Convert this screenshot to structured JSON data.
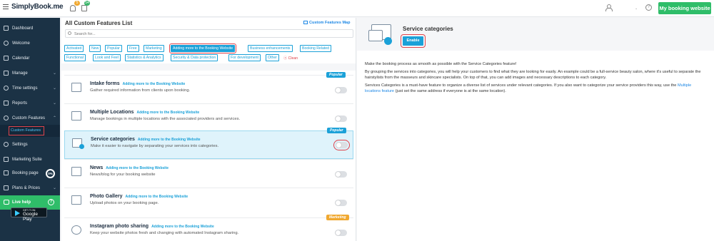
{
  "topbar": {
    "logo": "SimplyBook.me",
    "notifications_count": "5",
    "calendar_count": "54",
    "my_booking_website": "My booking website"
  },
  "sidebar": {
    "items": [
      {
        "label": "Dashboard",
        "icon": "dashboard-icon"
      },
      {
        "label": "Welcome",
        "icon": "welcome-icon"
      },
      {
        "label": "Calendar",
        "icon": "calendar-icon"
      },
      {
        "label": "Manage",
        "icon": "pencil-icon",
        "chevron": "⌄"
      },
      {
        "label": "Time settings",
        "icon": "clock-icon",
        "chevron": "⌄"
      },
      {
        "label": "Reports",
        "icon": "reports-icon",
        "chevron": "⌄"
      },
      {
        "label": "Custom Features",
        "icon": "gear-icon",
        "chevron": "⌃"
      },
      {
        "label": "Settings",
        "icon": "settings-icon"
      },
      {
        "label": "Marketing Suite",
        "icon": "megaphone-icon"
      },
      {
        "label": "Booking page",
        "icon": "booking-page-icon"
      },
      {
        "label": "Plans & Prices",
        "icon": "plans-icon",
        "chevron": "⌄"
      }
    ],
    "sub_item": "Custom Features",
    "booking_progress": "0%",
    "live_help": "Live help",
    "gplay_small": "GET IT ON",
    "gplay_big": "Google Play",
    "appstore": "Download on the"
  },
  "list": {
    "title": "All Custom Features List",
    "features_map": "Custom Features Map",
    "search_placeholder": "Search for...",
    "chips": [
      "Activated",
      "New",
      "Popular",
      "Free",
      "Marketing",
      "Adding more to the Booking Website",
      "Business enhancements",
      "Booking Related",
      "Functional",
      "Look and Feel",
      "Statistics & Analytics",
      "Security & Data protection",
      "For development",
      "Other"
    ],
    "clean": "Clean",
    "features": [
      {
        "name": "Intake forms",
        "tag": "Adding more to the Booking Website",
        "desc": "Gather required information from clients upon booking.",
        "badge": "Popular"
      },
      {
        "name": "Multiple Locations",
        "tag": "Adding more to the Booking Website",
        "desc": "Manage bookings in multiple locations with the associated providers and services.",
        "badge": ""
      },
      {
        "name": "Service categories",
        "tag": "Adding more to the Booking Website",
        "desc": "Make it easier to navigate by separating your services into categories.",
        "badge": "Popular"
      },
      {
        "name": "News",
        "tag": "Adding more to the Booking Website",
        "desc": "News/blog for your booking website",
        "badge": ""
      },
      {
        "name": "Photo Gallery",
        "tag": "Adding more to the Booking Website",
        "desc": "Upload photos on your booking page.",
        "badge": ""
      },
      {
        "name": "Instagram photo sharing",
        "tag": "Adding more to the Booking Website",
        "desc": "Keep your website photos fresh and changing with automated Instagram sharing.",
        "badge": "Marketing"
      }
    ]
  },
  "detail": {
    "title": "Service categories",
    "enable": "Enable",
    "p1": "Make the booking process as smooth as possible with the Service Categories feature!",
    "p2": "By grouping the services into categories, you will help your customers to find what they are looking for easily. An example could be a full-service beauty salon, where it's useful to separate the hairstylists from the masseurs and skincare specialists. On top of that, you can add images and necessary descriptions to each category.",
    "p3_a": "Services Categories is a must-have feature to organize a diverse list of services under relevant categories. If you also want to categorize your service providers this way, use the",
    "p3_link": "Multiple locations feature",
    "p3_b": "(just set the same address if everyone is at the same location)."
  }
}
